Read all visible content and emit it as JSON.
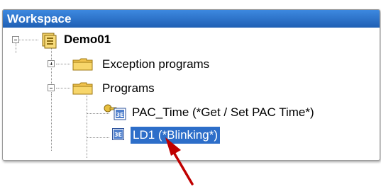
{
  "workspace": {
    "title": "Workspace",
    "tree": {
      "root": {
        "label": "Demo01",
        "icon": "project-icon",
        "expanded": true
      },
      "items": [
        {
          "label": "Exception programs",
          "icon": "folder-icon",
          "expanded": false
        },
        {
          "label": "Programs",
          "icon": "folder-icon",
          "expanded": true,
          "children": [
            {
              "label": "PAC_Time (*Get / Set PAC Time*)",
              "icon": "program-key-icon"
            },
            {
              "label": "LD1 (*Blinking*)",
              "icon": "program-icon",
              "selected": true
            }
          ]
        }
      ]
    }
  },
  "annotation": {
    "icon": "pointer-arrow-icon",
    "color": "#c00000"
  },
  "colors": {
    "titlebar": "#2f78d4",
    "selection": "#2d6ec9",
    "folder": "#f2c44f"
  }
}
